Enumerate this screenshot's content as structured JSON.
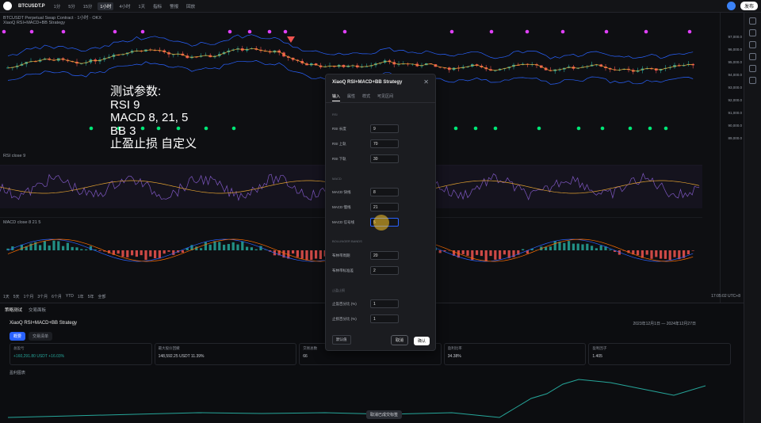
{
  "topbar": {
    "symbol": "BTCUSDT.P",
    "timeframes": [
      "1分",
      "5分",
      "15分",
      "1小时",
      "4小时",
      "1天"
    ],
    "active_timeframe": "1小时",
    "indicators_label": "指标",
    "alert_label": "警报",
    "replay_label": "回放",
    "share_label": "发布"
  },
  "chart": {
    "title_line": "BTCUSDT Perpetual Swap Contract · 1小时 · OKX",
    "indicator_line": "XiaoQ RSI+MACD+BB Strategy",
    "rsi_legend": "RSI close 9",
    "macd_legend": "MACD close 8 21 5",
    "overlay_text": "测试参数:\nRSI 9\nMACD 8, 21, 5\nBB 3\n止盈止损 自定义",
    "price_labels": [
      "97,000.0",
      "96,000.0",
      "95,000.0",
      "94,000.0",
      "93,000.0",
      "92,000.0",
      "91,000.0",
      "90,000.0",
      "89,000.0"
    ],
    "timeframe_buttons": [
      "1天",
      "5天",
      "1个月",
      "3个月",
      "6个月",
      "YTD",
      "1年",
      "5年",
      "全部"
    ],
    "clock": "17:05:02 UTC+8",
    "colors": {
      "up": "#26a69a",
      "down": "#ef5350",
      "bb": "#2962ff",
      "signal_top": "#e040fb",
      "signal_bottom": "#00e676"
    }
  },
  "bottom_panel": {
    "tabs": [
      "策略测试",
      "交易面板"
    ],
    "strategy_name": "XiaoQ RSI+MACD+BB Strategy",
    "date_range": "2023年12月1日 — 2024年12月27日",
    "subtabs": [
      "概要",
      "交易清单"
    ],
    "stats": [
      {
        "label": "总盈亏",
        "value": "+160,291.80 USDT +16.03%",
        "green": true
      },
      {
        "label": "最大股价回撤",
        "value": "148,592.25 USDT 11.39%",
        "green": false
      },
      {
        "label": "交易总数",
        "value": "66",
        "green": false
      },
      {
        "label": "盈利比率",
        "value": "34.38%",
        "green": false
      },
      {
        "label": "盈利因子",
        "value": "1.405",
        "green": false
      }
    ],
    "equity_label": "盈利图表",
    "tooltip_button": "取消已成交标签"
  },
  "dialog": {
    "title": "XiaoQ RSI+MACD+BB Strategy",
    "tabs": [
      "输入",
      "属性",
      "样式",
      "可见区间"
    ],
    "active_tab": "输入",
    "sections": {
      "rsi": "RSI",
      "macd": "MACD",
      "bb": "BOLLINGER BANDS",
      "tpsl": "止盈止损"
    },
    "fields": [
      {
        "label": "RSI 长度",
        "value": "9"
      },
      {
        "label": "RSI 上轨",
        "value": "70"
      },
      {
        "label": "RSI 下轨",
        "value": "30"
      },
      {
        "label": "MACD 快线",
        "value": "8"
      },
      {
        "label": "MACD 慢线",
        "value": "21"
      },
      {
        "label": "MACD 信号线",
        "value": "5"
      },
      {
        "label": "布林带周期",
        "value": "20"
      },
      {
        "label": "布林带标准差",
        "value": "2"
      },
      {
        "label": "止盈百分比 (%)",
        "value": "1"
      },
      {
        "label": "止损百分比 (%)",
        "value": "1"
      }
    ],
    "defaults_label": "默认值",
    "cancel_label": "取消",
    "ok_label": "确认"
  }
}
